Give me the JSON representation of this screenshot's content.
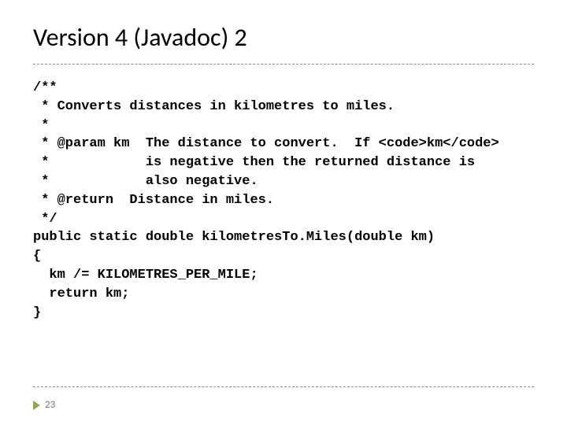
{
  "title": "Version 4 (Javadoc) 2",
  "code": {
    "l1": "/**",
    "l2": " * Converts distances in kilometres to miles.",
    "l3": " *",
    "l4": " * @param km  The distance to convert.  If <code>km</code>",
    "l5": " *            is negative then the returned distance is",
    "l6": " *            also negative.",
    "l7": " * @return  Distance in miles.",
    "l8": " */",
    "l9": "public static double kilometresTo.Miles(double km)",
    "l10": "{",
    "l11": "  km /= KILOMETRES_PER_MILE;",
    "l12": "  return km;",
    "l13": "}"
  },
  "page_number": "23"
}
